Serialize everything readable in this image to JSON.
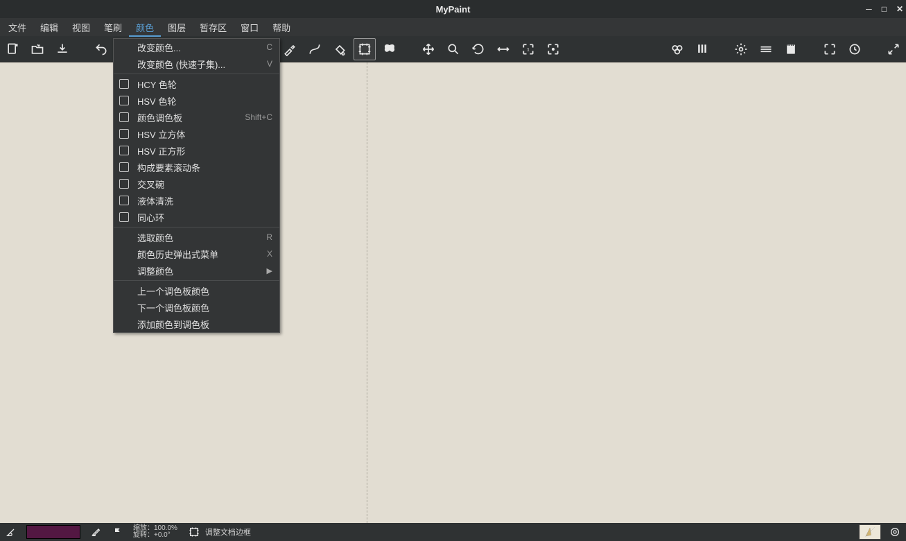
{
  "window": {
    "title": "MyPaint"
  },
  "menubar": {
    "items": [
      {
        "label": "文件",
        "name": "menu-file"
      },
      {
        "label": "编辑",
        "name": "menu-edit"
      },
      {
        "label": "视图",
        "name": "menu-view"
      },
      {
        "label": "笔刷",
        "name": "menu-brush"
      },
      {
        "label": "颜色",
        "name": "menu-color",
        "active": true
      },
      {
        "label": "图层",
        "name": "menu-layer"
      },
      {
        "label": "暂存区",
        "name": "menu-scratch"
      },
      {
        "label": "窗口",
        "name": "menu-window"
      },
      {
        "label": "帮助",
        "name": "menu-help"
      }
    ]
  },
  "dropdown": {
    "change_color": "改变颜色...",
    "change_color_accel": "C",
    "change_color_quick": "改变颜色 (快速子集)...",
    "change_color_quick_accel": "V",
    "hcy_wheel": "HCY 色轮",
    "hsv_wheel": "HSV 色轮",
    "palette": "颜色调色板",
    "palette_accel": "Shift+C",
    "hsv_cube": "HSV 立方体",
    "hsv_square": "HSV 正方形",
    "components": "构成要素滚动条",
    "cross_bowl": "交叉碗",
    "liquid_wash": "液体清洗",
    "concentric": "同心环",
    "pick_color": "选取颜色",
    "pick_color_accel": "R",
    "history_popup": "颜色历史弹出式菜单",
    "history_popup_accel": "X",
    "adjust_color": "调整颜色",
    "prev_palette": "上一个调色板颜色",
    "next_palette": "下一个调色板颜色",
    "add_to_palette": "添加颜色到调色板"
  },
  "status": {
    "zoom_label": "缩放：",
    "zoom_value": "100.0%",
    "rotate_label": "旋转：",
    "rotate_value": "+0.0°",
    "mode_text": "调整文档边框"
  },
  "colors": {
    "swatch": "#531742",
    "canvas": "#e2ddd2"
  }
}
